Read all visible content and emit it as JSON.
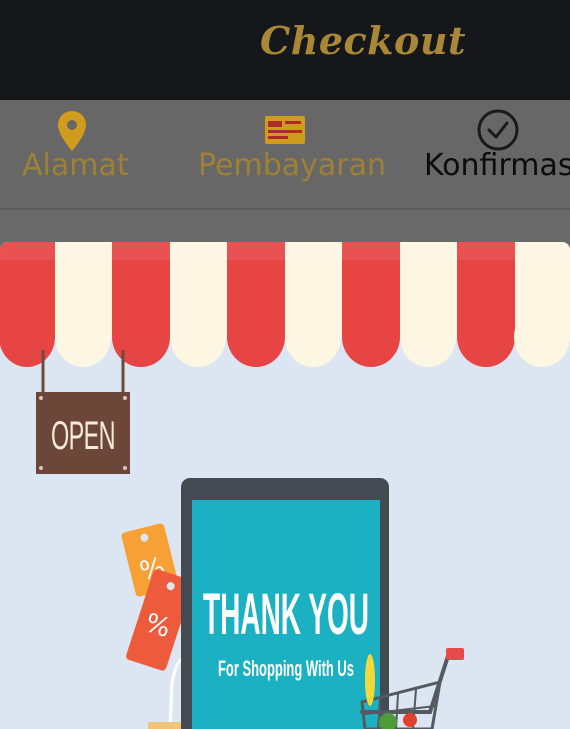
{
  "header": {
    "title": "Checkout"
  },
  "steps": [
    {
      "label": "Alamat",
      "icon": "map-pin-icon",
      "state": "completed"
    },
    {
      "label": "Pembayaran",
      "icon": "credit-card-icon",
      "state": "completed"
    },
    {
      "label": "Konfirmasi",
      "icon": "check-circle-icon",
      "state": "active"
    }
  ],
  "illustration": {
    "sign_text": "OPEN",
    "screen_title": "THANK YOU",
    "screen_subtitle": "For Shopping With Us",
    "tag_symbol": "%"
  },
  "colors": {
    "header_bg": "#16171b",
    "accent_gold": "#a88836",
    "steps_bg": "#676767",
    "awning_red": "#e74444",
    "awning_cream": "#fdf6e3",
    "screen_teal": "#1bb1c2"
  }
}
